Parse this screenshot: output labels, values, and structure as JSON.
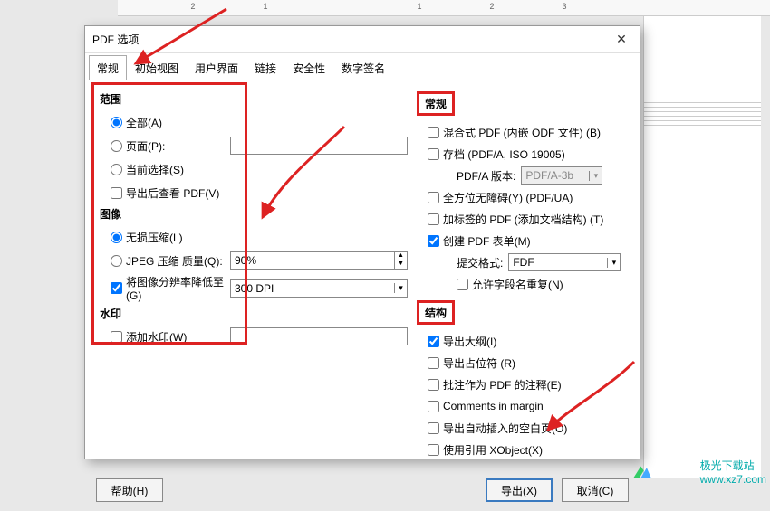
{
  "dialog": {
    "title": "PDF 选项"
  },
  "tabs": [
    "常规",
    "初始视图",
    "用户界面",
    "链接",
    "安全性",
    "数字签名"
  ],
  "range": {
    "title": "范围",
    "all": "全部(A)",
    "pages": "页面(P):",
    "selection": "当前选择(S)",
    "view_after": "导出后查看 PDF(V)"
  },
  "image": {
    "title": "图像",
    "lossless": "无损压缩(L)",
    "jpeg": "JPEG 压缩 质量(Q):",
    "reduce": "将图像分辨率降低至(G)",
    "quality_value": "90%",
    "dpi_value": "300 DPI"
  },
  "watermark": {
    "title": "水印",
    "add": "添加水印(W)"
  },
  "general": {
    "title": "常规",
    "hybrid": "混合式 PDF (内嵌 ODF 文件) (B)",
    "archive": "存档 (PDF/A, ISO 19005)",
    "pdfa_label": "PDF/A 版本:",
    "pdfa_value": "PDF/A-3b",
    "ua": "全方位无障碍(Y) (PDF/UA)",
    "tagged": "加标签的 PDF (添加文档结构) (T)",
    "forms": "创建 PDF 表单(M)",
    "submit_label": "提交格式:",
    "submit_value": "FDF",
    "dup_fields": "允许字段名重复(N)"
  },
  "structure": {
    "title": "结构",
    "outline": "导出大纲(I)",
    "placeholders": "导出占位符 (R)",
    "comments": "批注作为 PDF 的注释(E)",
    "margin_comments": "Comments in margin",
    "blank": "导出自动插入的空白页(O)",
    "xobject": "使用引用 XObject(X)"
  },
  "buttons": {
    "help": "帮助(H)",
    "export": "导出(X)",
    "cancel": "取消(C)"
  },
  "site": {
    "name": "极光下载站",
    "url": "www.xz7.com"
  }
}
